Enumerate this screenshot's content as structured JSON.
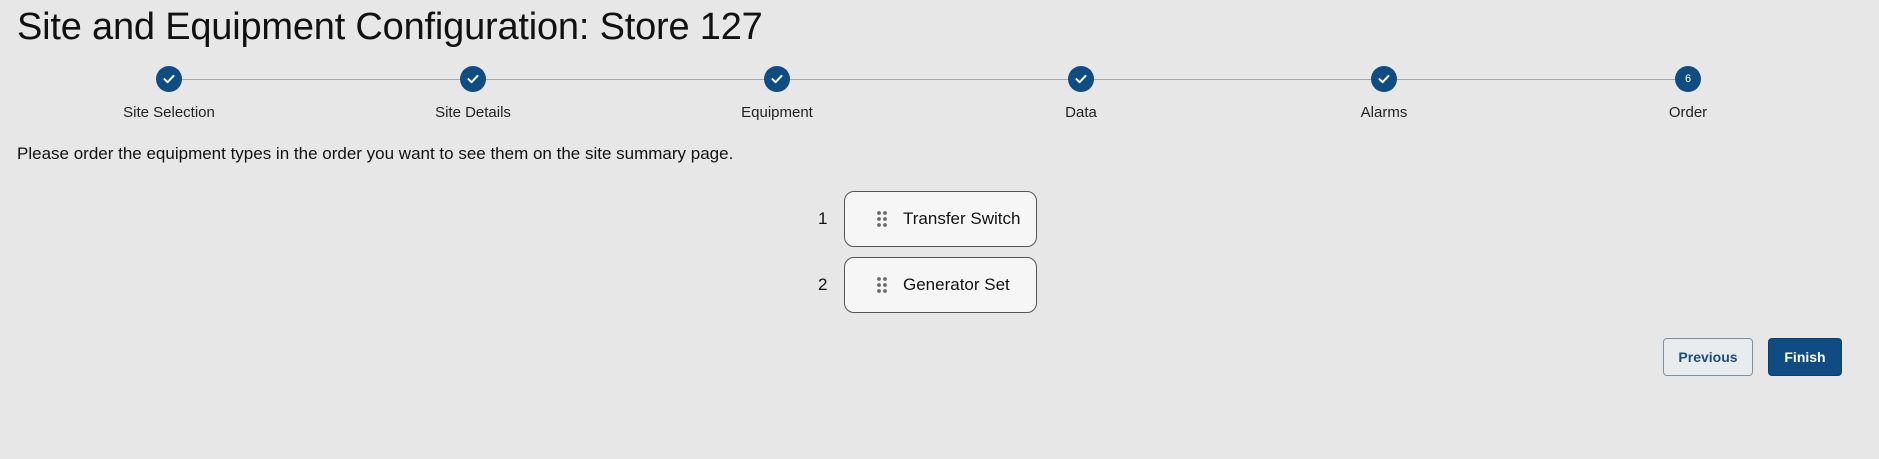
{
  "page": {
    "title": "Site and Equipment Configuration: Store 127",
    "instructions": "Please order the equipment types in the order you want to see them on the site summary page."
  },
  "stepper": {
    "steps": [
      {
        "label": "Site Selection",
        "state": "complete",
        "icon": "check-icon"
      },
      {
        "label": "Site Details",
        "state": "complete",
        "icon": "check-icon"
      },
      {
        "label": "Equipment",
        "state": "complete",
        "icon": "check-icon"
      },
      {
        "label": "Data",
        "state": "complete",
        "icon": "check-icon"
      },
      {
        "label": "Alarms",
        "state": "complete",
        "icon": "check-icon"
      },
      {
        "label": "Order",
        "state": "active",
        "number": "6"
      }
    ]
  },
  "order_list": {
    "items": [
      {
        "position": "1",
        "label": "Transfer Switch",
        "icon": "drag-handle-icon"
      },
      {
        "position": "2",
        "label": "Generator Set",
        "icon": "drag-handle-icon"
      }
    ]
  },
  "actions": {
    "previous_label": "Previous",
    "finish_label": "Finish"
  },
  "colors": {
    "primary": "#0f4c81",
    "background": "#e7e7e7",
    "item_background": "#f6f6f6"
  }
}
